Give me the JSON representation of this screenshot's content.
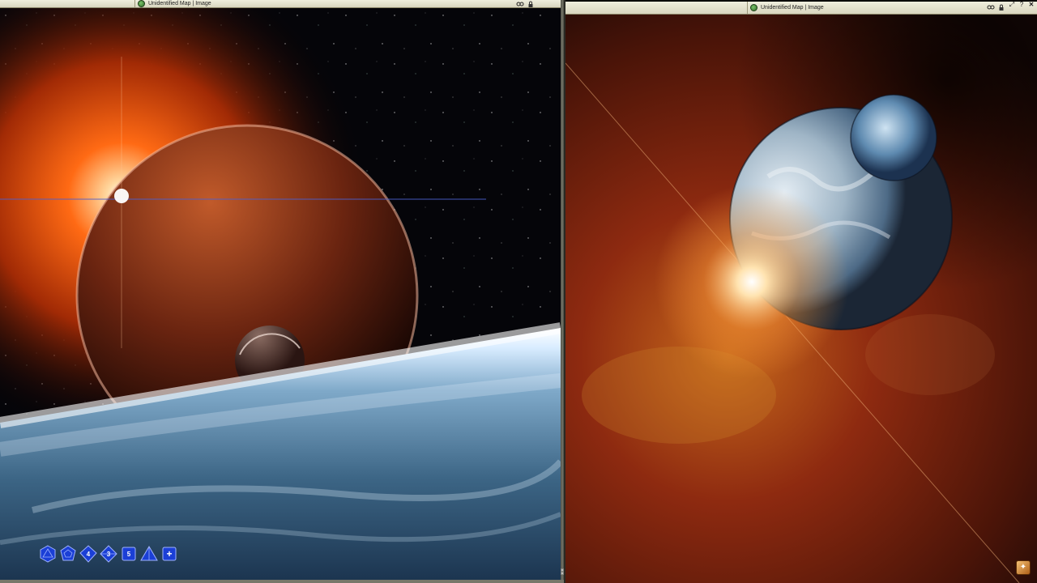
{
  "windows": [
    {
      "title": "Unidentified Map | Image",
      "app_icon": "id-badge-icon",
      "buttons": [
        "privacy-icon",
        "lock-icon"
      ]
    },
    {
      "title": "Unidentified Map | Image",
      "app_icon": "id-badge-icon",
      "buttons": [
        "privacy-icon",
        "lock-icon",
        "resize-icon",
        "help-icon",
        "close-icon"
      ]
    }
  ],
  "dice": [
    {
      "name": "d20",
      "label": ""
    },
    {
      "name": "d12",
      "label": ""
    },
    {
      "name": "d10",
      "label": "4"
    },
    {
      "name": "d8",
      "label": "3"
    },
    {
      "name": "d6",
      "label": "5"
    },
    {
      "name": "d4",
      "label": ""
    },
    {
      "name": "add-die",
      "label": "+"
    }
  ],
  "colors": {
    "titlebar": "#e6e3cc",
    "dice": "#1b3fd6",
    "corner_badge": "#e08c2c"
  }
}
